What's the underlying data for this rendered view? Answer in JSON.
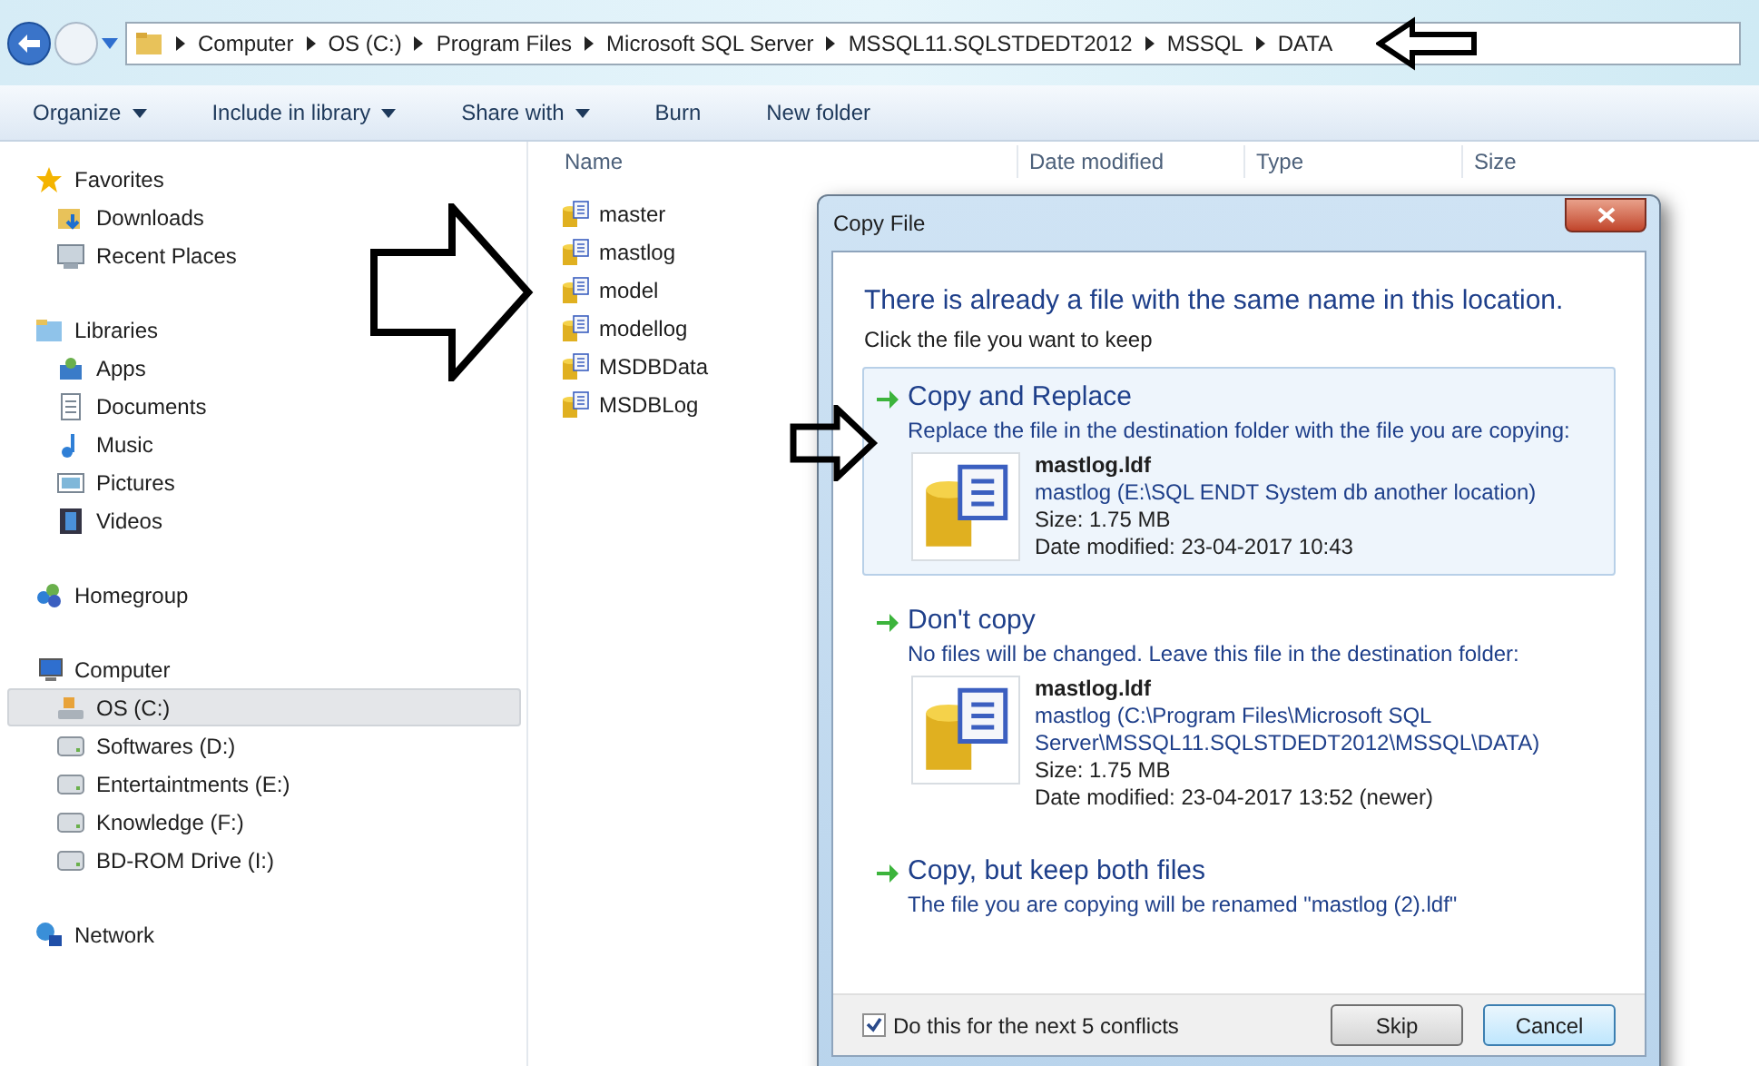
{
  "address_bar": {
    "crumbs": [
      "Computer",
      "OS (C:)",
      "Program Files",
      "Microsoft SQL Server",
      "MSSQL11.SQLSTDEDT2012",
      "MSSQL",
      "DATA"
    ]
  },
  "toolbar": [
    {
      "label": "Organize",
      "dropdown": true
    },
    {
      "label": "Include in library",
      "dropdown": true
    },
    {
      "label": "Share with",
      "dropdown": true
    },
    {
      "label": "Burn",
      "dropdown": false
    },
    {
      "label": "New folder",
      "dropdown": false
    }
  ],
  "sidebar": [
    {
      "label": "Favorites",
      "children": [
        {
          "label": "Downloads",
          "selected": false
        },
        {
          "label": "Recent Places",
          "selected": false
        }
      ]
    },
    {
      "label": "Libraries",
      "children": [
        {
          "label": "Apps",
          "selected": false
        },
        {
          "label": "Documents",
          "selected": false
        },
        {
          "label": "Music",
          "selected": false
        },
        {
          "label": "Pictures",
          "selected": false
        },
        {
          "label": "Videos",
          "selected": false
        }
      ]
    },
    {
      "label": "Homegroup"
    },
    {
      "label": "Computer",
      "children": [
        {
          "label": "OS (C:)",
          "selected": true
        },
        {
          "label": "Softwares (D:)",
          "selected": false
        },
        {
          "label": "Entertaintments (E:)",
          "selected": false
        },
        {
          "label": "Knowledge (F:)",
          "selected": false
        },
        {
          "label": "BD-ROM Drive (I:)",
          "selected": false
        }
      ]
    },
    {
      "label": "Network"
    }
  ],
  "file_list": {
    "columns": [
      "Name",
      "Date modified",
      "Type",
      "Size"
    ],
    "files": [
      "master",
      "mastlog",
      "model",
      "modellog",
      "MSDBData",
      "MSDBLog"
    ]
  },
  "dialog": {
    "title": "Copy File",
    "heading": "There is already a file with the same name in this location.",
    "subheading": "Click the file you want to keep",
    "options": [
      {
        "title": "Copy and Replace",
        "description": "Replace the file in the destination folder with the file you are copying:",
        "selected": true,
        "file": {
          "name": "mastlog.ldf",
          "location": "mastlog (E:\\SQL ENDT System db another location)",
          "size": "Size: 1.75 MB",
          "date": "Date modified: 23-04-2017 10:43"
        }
      },
      {
        "title": "Don't copy",
        "description": "No files will be changed. Leave this file in the destination folder:",
        "selected": false,
        "file": {
          "name": "mastlog.ldf",
          "location": "mastlog (C:\\Program Files\\Microsoft SQL Server\\MSSQL11.SQLSTDEDT2012\\MSSQL\\DATA)",
          "size": "Size: 1.75 MB",
          "date": "Date modified: 23-04-2017 13:52 (newer)"
        }
      },
      {
        "title": "Copy, but keep both files",
        "description": "The file you are copying will be renamed \"mastlog (2).ldf\"",
        "selected": false
      }
    ],
    "repeat_checkbox": {
      "label": "Do this for the next 5 conflicts",
      "checked": true
    },
    "buttons": [
      {
        "label": "Skip",
        "default": false
      },
      {
        "label": "Cancel",
        "default": true
      }
    ]
  }
}
